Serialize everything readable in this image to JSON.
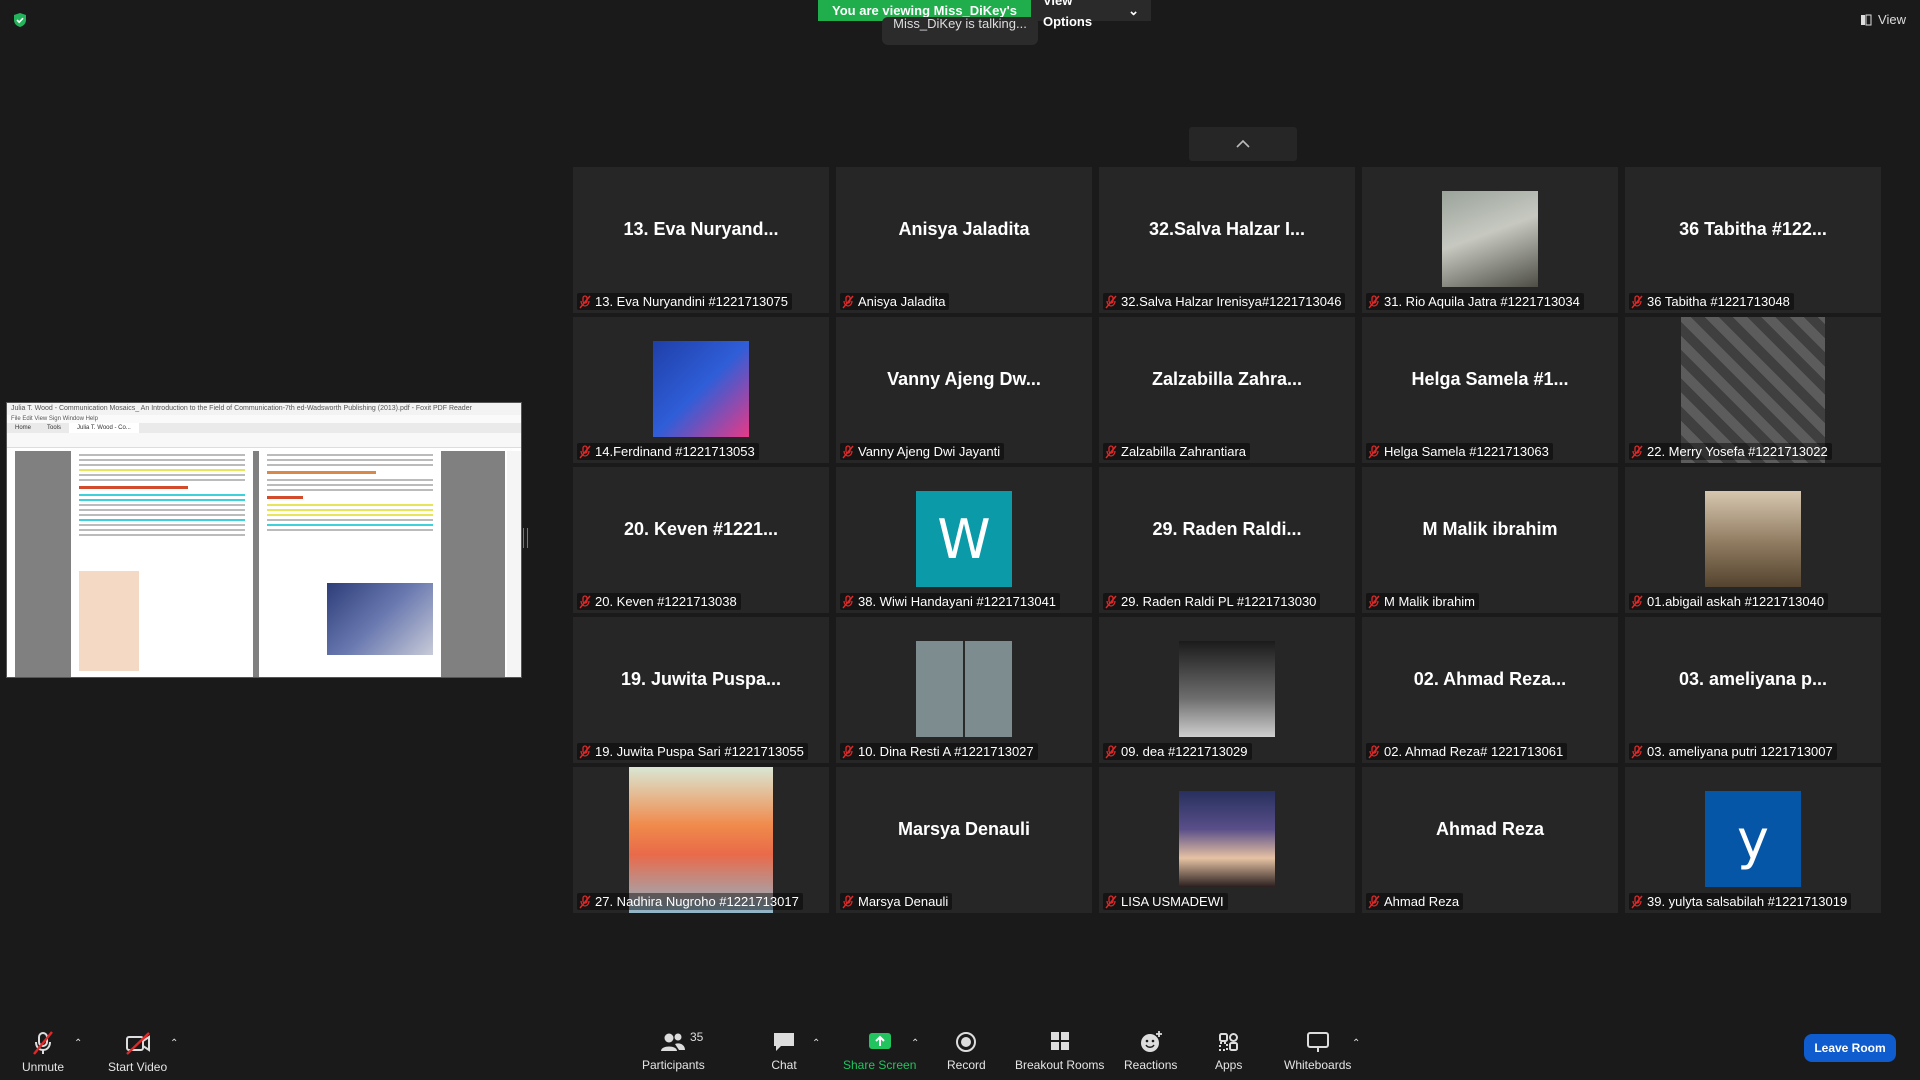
{
  "banner": {
    "viewing_text": "You are viewing Miss_DiKey's screen",
    "view_options_label": "View Options",
    "talking_text": "Miss_DiKey is talking..."
  },
  "top_right": {
    "view_label": "View"
  },
  "share_preview": {
    "window_title": "Julia T. Wood - Communication Mosaics_ An Introduction to the Field of Communication-7th ed-Wadsworth Publishing (2013).pdf - Foxit PDF Reader",
    "menu": "File  Edit  View  Sign  Window  Help",
    "tabs": [
      "Home",
      "Tools",
      "Julia T. Wood - Co..."
    ],
    "section_heading_left": "Potential Strengths of Groups",
    "section_heading_right": "Features of Small Groups"
  },
  "participants": [
    {
      "display": "13. Eva Nuryand...",
      "label": "13. Eva Nuryandini #1221713075",
      "type": "name"
    },
    {
      "display": "Anisya Jaladita",
      "label": "Anisya Jaladita",
      "type": "name"
    },
    {
      "display": "32.Salva Halzar I...",
      "label": "32.Salva Halzar Irenisya#1221713046",
      "type": "name"
    },
    {
      "display": "",
      "label": "31. Rio Aquila Jatra #1221713034",
      "type": "photo",
      "photo": "portrait-photo"
    },
    {
      "display": "36 Tabitha #122...",
      "label": "36 Tabitha #1221713048",
      "type": "name"
    },
    {
      "display": "",
      "label": "14.Ferdinand #1221713053",
      "type": "photo",
      "photo": "xl-axiata-26th-logo"
    },
    {
      "display": "Vanny Ajeng Dw...",
      "label": "Vanny Ajeng Dwi Jayanti",
      "type": "name"
    },
    {
      "display": "Zalzabilla Zahra...",
      "label": "Zalzabilla Zahrantiara",
      "type": "name"
    },
    {
      "display": "Helga Samela #1...",
      "label": "Helga Samela #1221713063",
      "type": "name"
    },
    {
      "display": "",
      "label": "22. Merry Yosefa #1221713022",
      "type": "photo-tall",
      "photo": "standing-woman-photo"
    },
    {
      "display": "20. Keven #1221...",
      "label": "20. Keven #1221713038",
      "type": "name"
    },
    {
      "display": "W",
      "label": "38. Wiwi Handayani #1221713041",
      "type": "letter",
      "color": "#0a9aa8"
    },
    {
      "display": "29. Raden Raldi...",
      "label": "29. Raden Raldi PL #1221713030",
      "type": "name"
    },
    {
      "display": "M Malik ibrahim",
      "label": "M Malik ibrahim",
      "type": "name"
    },
    {
      "display": "",
      "label": "01.abigail askah #1221713040",
      "type": "photo",
      "photo": "group-photo"
    },
    {
      "display": "19. Juwita Puspa...",
      "label": "19. Juwita Puspa Sari #1221713055",
      "type": "name"
    },
    {
      "display": "",
      "label": "10. Dina Resti A #1221713027",
      "type": "photo",
      "photo": "hijab-selfie-photo"
    },
    {
      "display": "",
      "label": "09. dea #1221713029",
      "type": "photo",
      "photo": "event-poster"
    },
    {
      "display": "02. Ahmad Reza...",
      "label": "02. Ahmad Reza# 1221713061",
      "type": "name"
    },
    {
      "display": "03. ameliyana p...",
      "label": "03. ameliyana putri 1221713007",
      "type": "name"
    },
    {
      "display": "",
      "label": "27. Nadhira Nugroho #1221713017",
      "type": "photo-tall",
      "photo": "anime-ponyo-image"
    },
    {
      "display": "Marsya Denauli",
      "label": "Marsya Denauli",
      "type": "name"
    },
    {
      "display": "",
      "label": "LISA USMADEWI",
      "type": "photo",
      "photo": "smiling-woman-photo"
    },
    {
      "display": "Ahmad Reza",
      "label": "Ahmad Reza",
      "type": "name"
    },
    {
      "display": "y",
      "label": "39. yulyta salsabilah #1221713019",
      "type": "letter",
      "color": "#0656a8"
    }
  ],
  "toolbar": {
    "unmute": "Unmute",
    "start_video": "Start Video",
    "participants": "Participants",
    "participants_count": "35",
    "chat": "Chat",
    "share_screen": "Share Screen",
    "record": "Record",
    "breakout_rooms": "Breakout Rooms",
    "reactions": "Reactions",
    "apps": "Apps",
    "whiteboards": "Whiteboards",
    "leave": "Leave Room"
  },
  "colors": {
    "accent_green": "#1fae4b",
    "leave_blue": "#0e5ccd",
    "muted_red": "#e02828"
  }
}
